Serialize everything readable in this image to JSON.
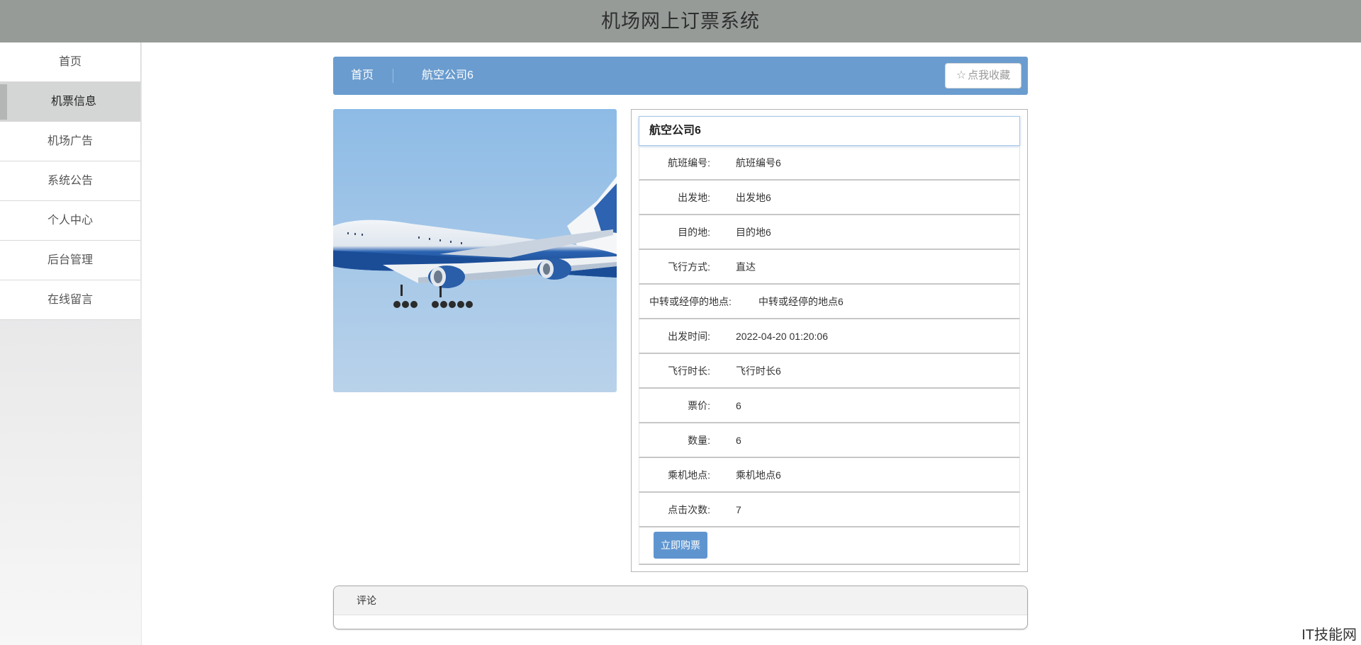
{
  "header": {
    "title": "机场网上订票系统"
  },
  "sidebar": {
    "items": [
      {
        "label": "首页"
      },
      {
        "label": "机票信息",
        "active": true
      },
      {
        "label": "机场广告"
      },
      {
        "label": "系统公告"
      },
      {
        "label": "个人中心"
      },
      {
        "label": "后台管理"
      },
      {
        "label": "在线留言"
      }
    ]
  },
  "breadcrumb": {
    "home": "首页",
    "current": "航空公司6"
  },
  "favorite": {
    "label": "点我收藏",
    "icon": "star-outline-icon"
  },
  "detail": {
    "title": "航空公司6",
    "fields": [
      {
        "label": "航班编号:",
        "value": "航班编号6"
      },
      {
        "label": "出发地:",
        "value": "出发地6"
      },
      {
        "label": "目的地:",
        "value": "目的地6"
      },
      {
        "label": "飞行方式:",
        "value": "直达"
      },
      {
        "label": "中转或经停的地点:",
        "value": "中转或经停的地点6"
      },
      {
        "label": "出发时间:",
        "value": "2022-04-20 01:20:06"
      },
      {
        "label": "飞行时长:",
        "value": "飞行时长6"
      },
      {
        "label": "票价:",
        "value": "6"
      },
      {
        "label": "数量:",
        "value": "6"
      },
      {
        "label": "乘机地点:",
        "value": "乘机地点6"
      },
      {
        "label": "点击次数:",
        "value": "7"
      }
    ],
    "buy_label": "立即购票"
  },
  "comments": {
    "title": "评论"
  },
  "watermark": "IT技能网",
  "colors": {
    "header_bg": "#969b98",
    "accent": "#6a9ccf",
    "button": "#5f95cf"
  }
}
